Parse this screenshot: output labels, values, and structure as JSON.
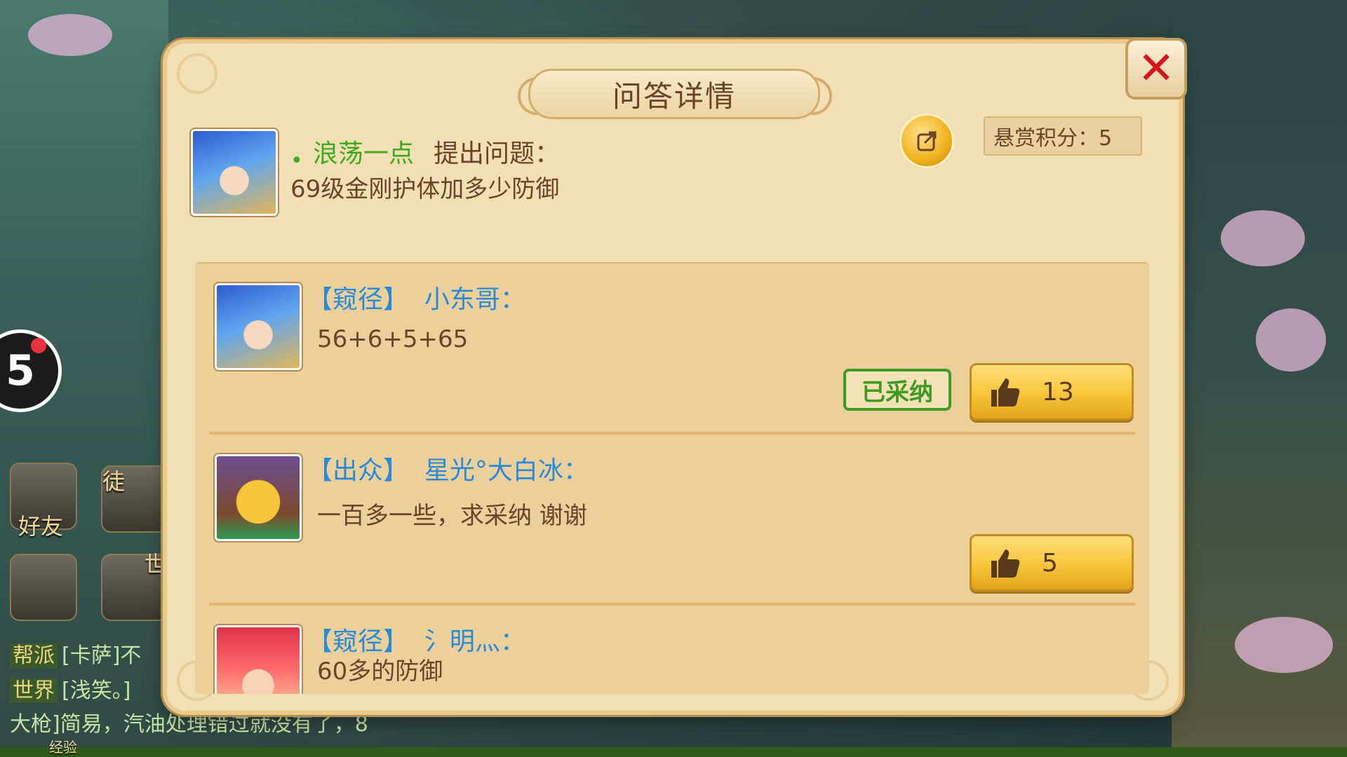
{
  "dialog": {
    "title": "问答详情",
    "close_icon": "close-icon",
    "asker": {
      "name": "浪荡一点",
      "suffix": "提出问题：",
      "question": "69级金刚护体加多少防御"
    },
    "reward_label": "悬赏积分：5"
  },
  "answers": [
    {
      "name": "【窥径】  小东哥：",
      "text": "56+6+5+65",
      "likes": "13",
      "adopted_label": "已采纳"
    },
    {
      "name": "【出众】  星光°大白冰：",
      "text": "一百多一些，求采纳 谢谢",
      "likes": "5"
    },
    {
      "name": "【窥径】  氵明灬：",
      "text": "60多的防御"
    }
  ],
  "hud": {
    "badge": "5",
    "friends_label": "好友",
    "apprentice_label": "徒",
    "world_label": "世",
    "chat": [
      {
        "tag": "帮派",
        "text": "[卡萨]不"
      },
      {
        "tag": "世界",
        "text": "[浅笑。]"
      },
      {
        "tag": "",
        "text": "大枪]简易，汽油处理错过就没有了，8"
      }
    ],
    "exp_label": "经验"
  },
  "colors": {
    "panel": "#f3dfb4",
    "asker_green": "#3ea91f",
    "name_blue": "#2a8ad6",
    "close_red": "#d7141b",
    "button_gold": "#f8c53a"
  }
}
